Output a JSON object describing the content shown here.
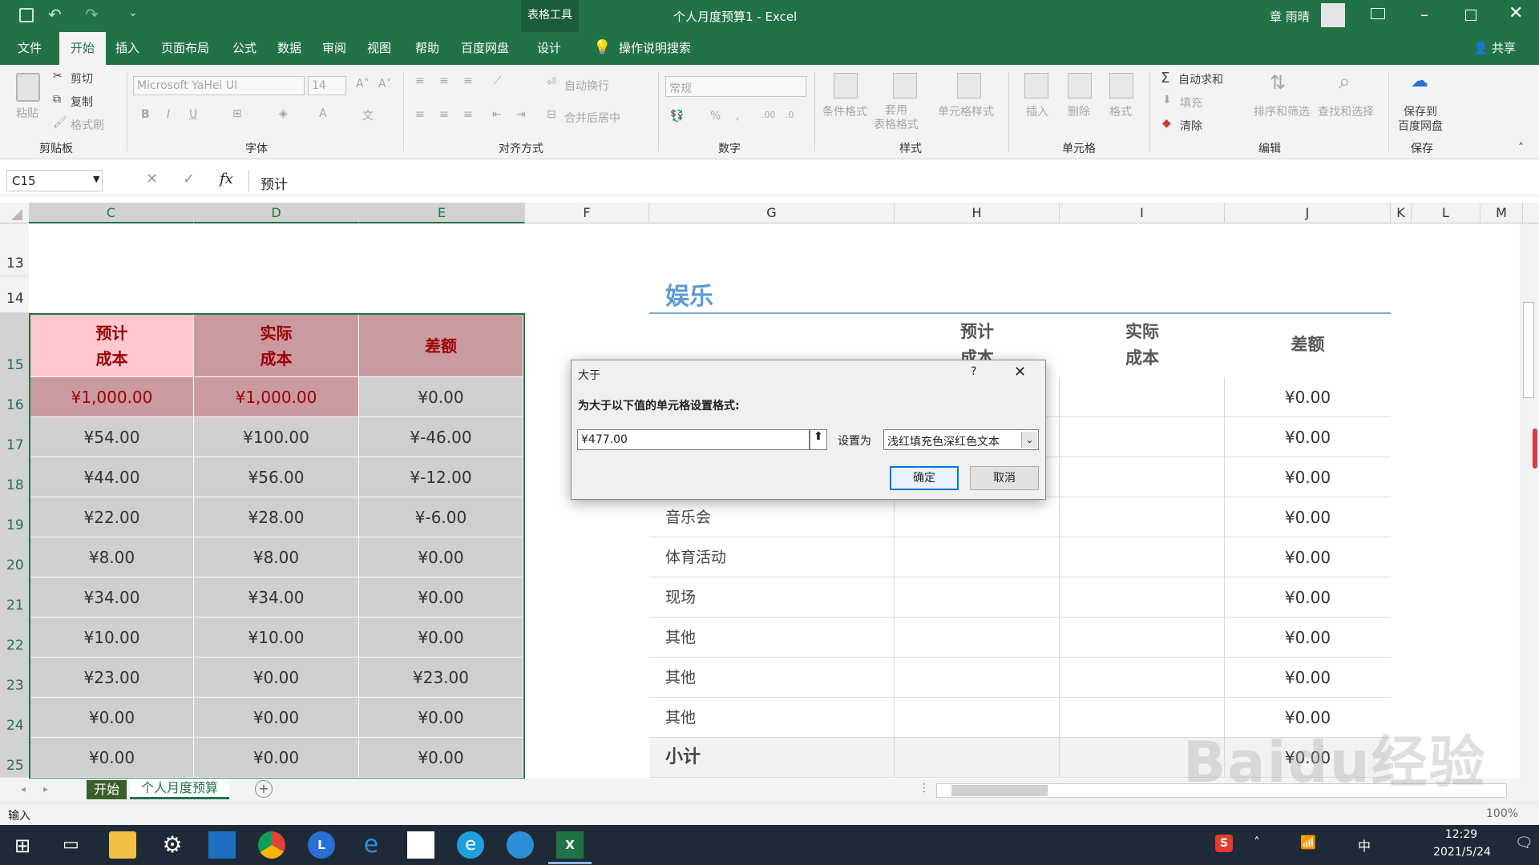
{
  "title": {
    "tools": "表格工具",
    "doc": "个人月度预算1  -  Excel",
    "user": "章 雨晴"
  },
  "tabs": [
    "文件",
    "开始",
    "插入",
    "页面布局",
    "公式",
    "数据",
    "审阅",
    "视图",
    "帮助",
    "百度网盘",
    "设计"
  ],
  "tellme": "操作说明搜索",
  "share": "共享",
  "ribbon": {
    "paste": "粘贴",
    "cut": "剪切",
    "copy": "复制",
    "format_painter": "格式刷",
    "clipboard": "剪贴板",
    "font_name": "Microsoft YaHei UI",
    "font_size": "14",
    "font": "字体",
    "wrap": "自动换行",
    "merge": "合并后居中",
    "alignment": "对齐方式",
    "num_format": "常规",
    "number": "数字",
    "cond_format": "条件格式",
    "table_format": "套用\n表格格式",
    "cell_style": "单元格样式",
    "styles": "样式",
    "insert": "插入",
    "delete": "删除",
    "format": "格式",
    "cells": "单元格",
    "autosum": "自动求和",
    "fill": "填充",
    "clear": "清除",
    "sort": "排序和筛选",
    "find": "查找和选择",
    "editing": "编辑",
    "save_baidu": "保存到\n百度网盘",
    "save": "保存"
  },
  "formula": {
    "namebox": "C15",
    "content": "预计"
  },
  "columns": [
    "C",
    "D",
    "E",
    "F",
    "G",
    "H",
    "I",
    "J",
    "K",
    "L",
    "M"
  ],
  "rows": [
    "13",
    "14",
    "15",
    "16",
    "17",
    "18",
    "19",
    "20",
    "21",
    "22",
    "23",
    "24",
    "25"
  ],
  "left_table": {
    "headers": [
      "预计\n成本",
      "实际\n成本",
      "差额"
    ],
    "rows": [
      [
        "¥1,000.00",
        "¥1,000.00",
        "¥0.00"
      ],
      [
        "¥54.00",
        "¥100.00",
        "¥-46.00"
      ],
      [
        "¥44.00",
        "¥56.00",
        "¥-12.00"
      ],
      [
        "¥22.00",
        "¥28.00",
        "¥-6.00"
      ],
      [
        "¥8.00",
        "¥8.00",
        "¥0.00"
      ],
      [
        "¥34.00",
        "¥34.00",
        "¥0.00"
      ],
      [
        "¥10.00",
        "¥10.00",
        "¥0.00"
      ],
      [
        "¥23.00",
        "¥0.00",
        "¥23.00"
      ],
      [
        "¥0.00",
        "¥0.00",
        "¥0.00"
      ],
      [
        "¥0.00",
        "¥0.00",
        "¥0.00"
      ]
    ]
  },
  "right_table": {
    "title": "娱乐",
    "headers": [
      "预计\n成本",
      "实际\n成本",
      "差额"
    ],
    "labels": [
      "",
      "",
      "",
      "音乐会",
      "体育活动",
      "现场",
      "其他",
      "其他",
      "其他",
      "小计"
    ],
    "diffs": [
      "¥0.00",
      "¥0.00",
      "¥0.00",
      "¥0.00",
      "¥0.00",
      "¥0.00",
      "¥0.00",
      "¥0.00",
      "¥0.00",
      "¥0.00"
    ]
  },
  "dialog": {
    "title": "大于",
    "help": "?",
    "prompt": "为大于以下值的单元格设置格式:",
    "value": "¥477.00",
    "set_as": "设置为",
    "format_option": "浅红填充色深红色文本",
    "ok": "确定",
    "cancel": "取消"
  },
  "sheets": [
    "开始",
    "个人月度预算"
  ],
  "status": {
    "mode": "输入",
    "zoom": "100%"
  },
  "taskbar": {
    "time": "12:29",
    "date": "2021/5/24",
    "ime": "中"
  },
  "watermark": "Baidu经验",
  "colors": {
    "excel_green": "#217346",
    "header_pink": "#ffc7ce",
    "header_rose": "#c99aa0",
    "selection_gray": "#cfcfcf",
    "dark_red": "#9c0006",
    "title_blue": "#5b9bd5"
  }
}
